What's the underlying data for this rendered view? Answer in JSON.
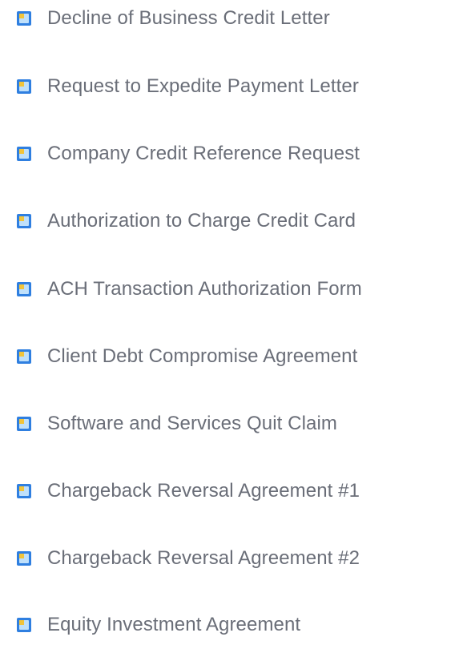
{
  "documents": [
    {
      "label": "Decline of Business Credit Letter",
      "icon": "document-icon"
    },
    {
      "label": "Request to Expedite Payment Letter",
      "icon": "document-icon"
    },
    {
      "label": "Company Credit Reference Request",
      "icon": "document-icon"
    },
    {
      "label": "Authorization to Charge Credit Card",
      "icon": "document-icon"
    },
    {
      "label": "ACH Transaction Authorization Form",
      "icon": "document-icon"
    },
    {
      "label": "Client Debt Compromise Agreement",
      "icon": "document-icon"
    },
    {
      "label": "Software and Services Quit Claim",
      "icon": "document-icon"
    },
    {
      "label": "Chargeback Reversal Agreement #1",
      "icon": "document-icon"
    },
    {
      "label": "Chargeback Reversal Agreement #2",
      "icon": "document-icon"
    },
    {
      "label": "Equity Investment Agreement",
      "icon": "document-icon"
    }
  ],
  "colors": {
    "link_text": "#6a6e78",
    "icon_blue": "#2f7fe0",
    "icon_light": "#bfe0fb",
    "icon_yellow": "#f2c43a"
  }
}
